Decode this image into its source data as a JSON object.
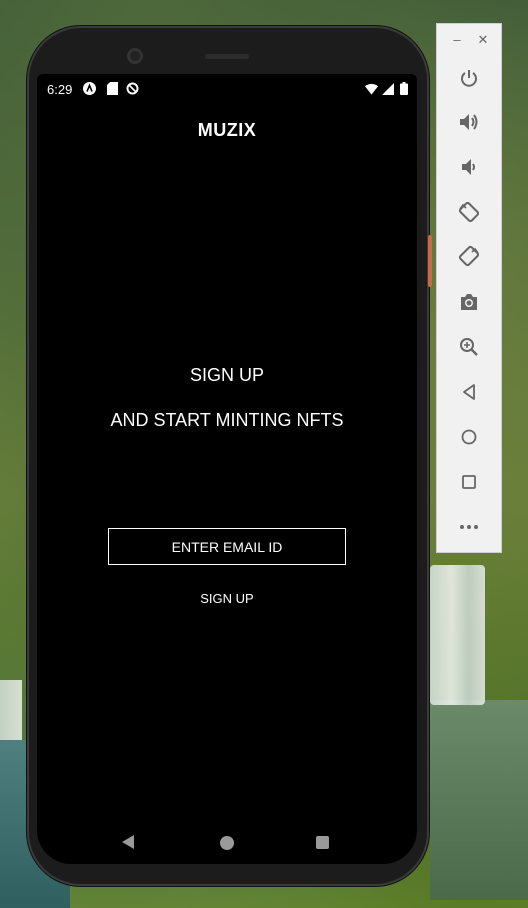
{
  "status_bar": {
    "time": "6:29",
    "icons": [
      "assistant-icon",
      "sd-card-icon",
      "data-saver-icon",
      "wifi-icon",
      "signal-icon",
      "battery-icon"
    ]
  },
  "app": {
    "title": "MUZIX",
    "headline_1": "SIGN UP",
    "headline_2": "AND START MINTING NFTS",
    "email_placeholder": "ENTER EMAIL ID",
    "email_value": "",
    "signup_label": "SIGN UP"
  },
  "nav_bar": {
    "items": [
      "back-icon",
      "home-icon",
      "recents-icon"
    ]
  },
  "emulator_toolbar": {
    "window_controls": [
      "minimize-icon",
      "close-icon"
    ],
    "buttons": [
      "power-icon",
      "volume-up-icon",
      "volume-down-icon",
      "rotate-left-icon",
      "rotate-right-icon",
      "screenshot-icon",
      "zoom-icon",
      "back-icon",
      "home-icon",
      "overview-icon",
      "more-icon"
    ]
  },
  "colors": {
    "screen_background": "#000000",
    "text": "#ffffff",
    "toolbar_background": "#f1f1f1",
    "toolbar_icon": "#666666",
    "nav_icon": "#9a9a9a",
    "side_button": "#c86a4a"
  }
}
